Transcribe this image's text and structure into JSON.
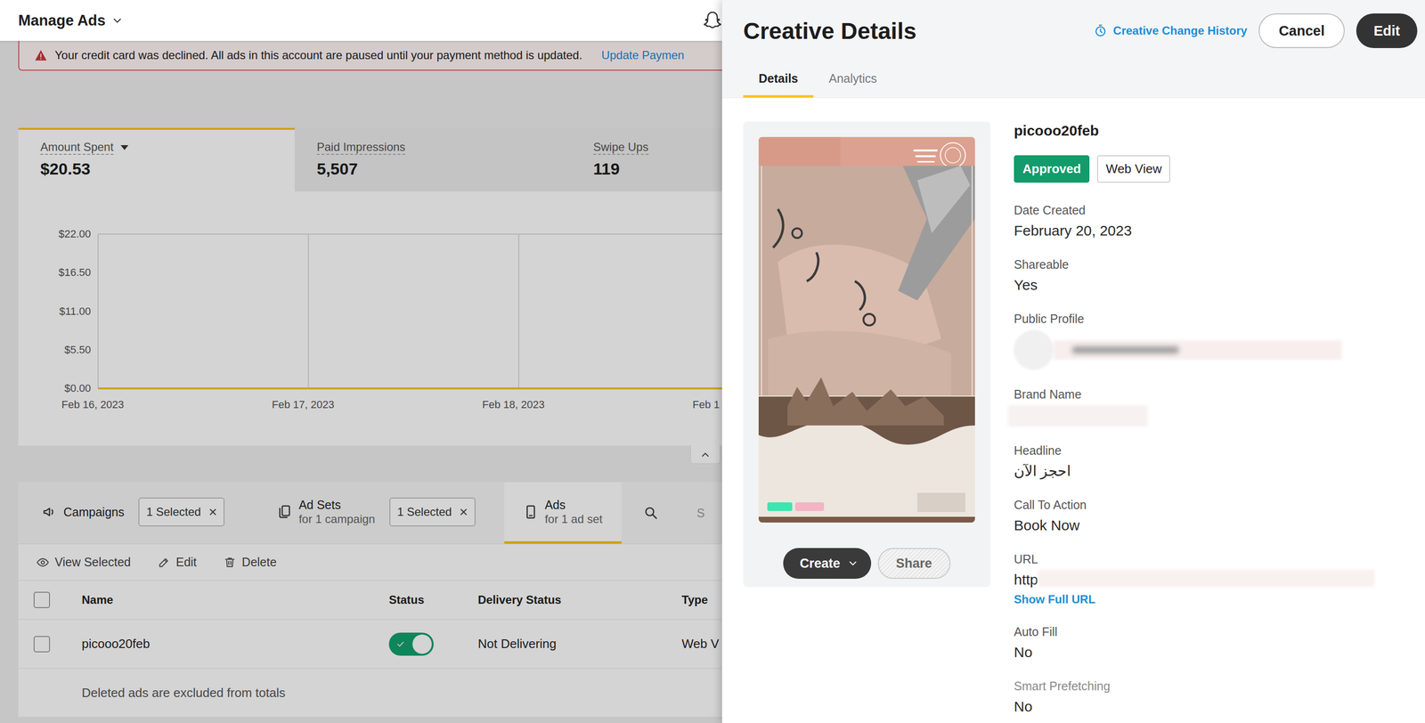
{
  "topbar": {
    "title": "Manage Ads"
  },
  "banner": {
    "message": "Your credit card was declined. All ads in this account are paused until your payment method is updated.",
    "link": "Update Paymen"
  },
  "stats": {
    "tabs": [
      {
        "label": "Amount Spent",
        "value": "$20.53",
        "selected": true,
        "kind": "dropdown"
      },
      {
        "label": "Paid Impressions",
        "value": "5,507",
        "selected": false,
        "kind": "plain"
      },
      {
        "label": "Swipe Ups",
        "value": "119",
        "selected": false,
        "kind": "plain"
      }
    ]
  },
  "chart": {
    "y_ticks": [
      "$22.00",
      "$16.50",
      "$11.00",
      "$5.50",
      "$0.00"
    ],
    "x_labels": [
      "Feb 16, 2023",
      "Feb 17, 2023",
      "Feb 18, 2023",
      "Feb 1"
    ],
    "series": [
      {
        "values": [
          0,
          0,
          0,
          0
        ]
      }
    ]
  },
  "nav": {
    "tabs": [
      {
        "label": "Campaigns",
        "chip": "1 Selected",
        "chip_close": "×",
        "selected": false,
        "kind": "campaigns"
      },
      {
        "label": "Ad Sets",
        "sub": "for 1 campaign",
        "chip": "1 Selected",
        "chip_close": "×",
        "selected": false,
        "kind": "ad-sets"
      },
      {
        "label": "Ads",
        "sub": "for 1 ad set",
        "selected": true,
        "kind": "ads"
      }
    ],
    "search_placeholder": "S"
  },
  "toolbar": {
    "actions": [
      {
        "label": "View Selected",
        "kind": "view"
      },
      {
        "label": "Edit",
        "kind": "edit"
      },
      {
        "label": "Delete",
        "kind": "delete"
      }
    ]
  },
  "table": {
    "select_all": false,
    "columns": [
      "Name",
      "Status",
      "Delivery Status",
      "Type"
    ],
    "rows": [
      {
        "selected": false,
        "name": "picooo20feb",
        "enabled": true,
        "delivery": "Not Delivering",
        "type": "Web V"
      }
    ],
    "footer": "Deleted ads are excluded from totals"
  },
  "panel": {
    "title": "Creative Details",
    "history": "Creative Change History",
    "cancel": "Cancel",
    "edit": "Edit",
    "tabs": [
      {
        "label": "Details",
        "selected": true
      },
      {
        "label": "Analytics",
        "selected": false
      }
    ],
    "preview": {
      "create": "Create",
      "share": "Share",
      "share_disabled": true
    },
    "name": "picooo20feb",
    "review_status": "Approved",
    "web_view": "Web View",
    "fields": [
      {
        "label": "Date Created",
        "value": "February 20, 2023",
        "kind": "text",
        "muted": false
      },
      {
        "label": "Shareable",
        "value": "Yes",
        "kind": "text",
        "muted": false
      },
      {
        "label": "Public Profile",
        "kind": "redacted-profile",
        "muted": false
      },
      {
        "label": "Brand Name",
        "kind": "redacted",
        "muted": false
      },
      {
        "label": "Headline",
        "value": "احجز الآن",
        "kind": "text",
        "muted": false
      },
      {
        "label": "Call To Action",
        "value": "Book Now",
        "kind": "text",
        "muted": false
      },
      {
        "label": "URL",
        "value": "http",
        "kind": "url",
        "link": "Show Full URL",
        "muted": false
      },
      {
        "label": "Auto Fill",
        "value": "No",
        "kind": "text",
        "muted": false
      },
      {
        "label": "Smart Prefetching",
        "value": "No",
        "kind": "text",
        "muted": true
      }
    ]
  }
}
